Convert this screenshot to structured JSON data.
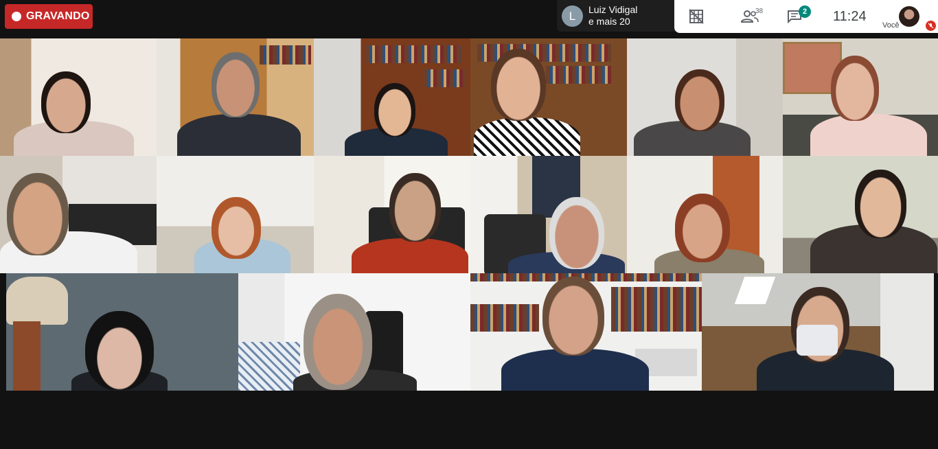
{
  "recording": {
    "label": "GRAVANDO"
  },
  "presenter": {
    "initial": "L",
    "line1": "Luiz Vidigal",
    "line2": "e mais 20"
  },
  "toolbar": {
    "participants_count": "38",
    "chat_unread": "2",
    "time": "11:24",
    "self_label": "Você"
  },
  "colors": {
    "recording": "#c62828",
    "chat_badge": "#00897b",
    "mic_off": "#d93025"
  }
}
